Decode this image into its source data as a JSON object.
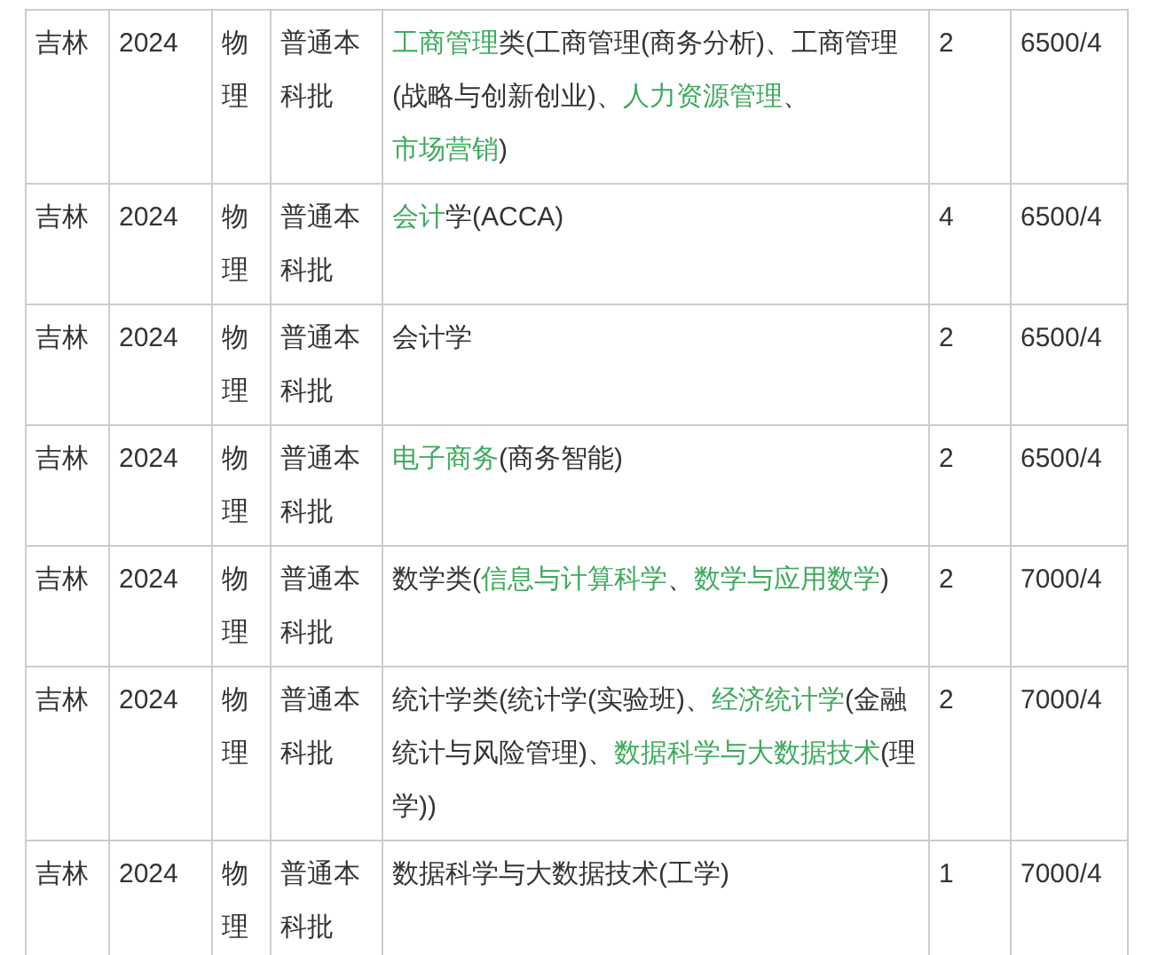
{
  "table": {
    "rows": [
      {
        "province": "吉林",
        "year": "2024",
        "subject": "物理",
        "batch": "普通本科批",
        "major": [
          {
            "text": "工商管理",
            "link": true
          },
          {
            "text": "类(工商管理(商务分析)、工商管理(战略与创新创业)、",
            "link": false
          },
          {
            "text": "人力资源管理",
            "link": true
          },
          {
            "text": "、",
            "link": false
          },
          {
            "text": "市场营销",
            "link": true
          },
          {
            "text": ")",
            "link": false
          }
        ],
        "count": "2",
        "fee": "6500/4"
      },
      {
        "province": "吉林",
        "year": "2024",
        "subject": "物理",
        "batch": "普通本科批",
        "major": [
          {
            "text": "会计",
            "link": true
          },
          {
            "text": "学(ACCA)",
            "link": false
          }
        ],
        "count": "4",
        "fee": "6500/4"
      },
      {
        "province": "吉林",
        "year": "2024",
        "subject": "物理",
        "batch": "普通本科批",
        "major": [
          {
            "text": "会计学",
            "link": false
          }
        ],
        "count": "2",
        "fee": "6500/4"
      },
      {
        "province": "吉林",
        "year": "2024",
        "subject": "物理",
        "batch": "普通本科批",
        "major": [
          {
            "text": "电子商务",
            "link": true
          },
          {
            "text": "(商务智能)",
            "link": false
          }
        ],
        "count": "2",
        "fee": "6500/4"
      },
      {
        "province": "吉林",
        "year": "2024",
        "subject": "物理",
        "batch": "普通本科批",
        "major": [
          {
            "text": "数学类(",
            "link": false
          },
          {
            "text": "信息与计算科学",
            "link": true
          },
          {
            "text": "、",
            "link": false
          },
          {
            "text": "数学与应用数学",
            "link": true
          },
          {
            "text": ")",
            "link": false
          }
        ],
        "count": "2",
        "fee": "7000/4"
      },
      {
        "province": "吉林",
        "year": "2024",
        "subject": "物理",
        "batch": "普通本科批",
        "major": [
          {
            "text": "统计学类(统计学(实验班)、",
            "link": false
          },
          {
            "text": "经济统计学",
            "link": true
          },
          {
            "text": "(金融统计与风险管理)、",
            "link": false
          },
          {
            "text": "数据科学与大数据技术",
            "link": true
          },
          {
            "text": "(理学))",
            "link": false
          }
        ],
        "count": "2",
        "fee": "7000/4"
      },
      {
        "province": "吉林",
        "year": "2024",
        "subject": "物理",
        "batch": "普通本科批",
        "major": [
          {
            "text": "数据科学与大数据技术(工学)",
            "link": false
          }
        ],
        "count": "1",
        "fee": "7000/4"
      }
    ]
  }
}
